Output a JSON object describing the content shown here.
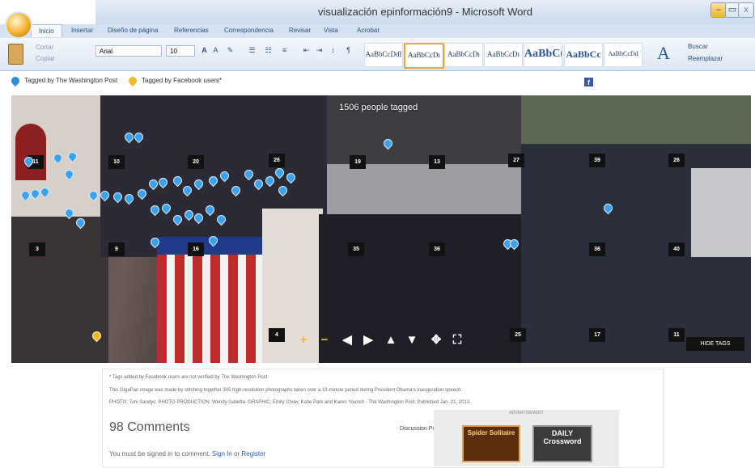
{
  "window": {
    "title": "visualización epinformación9 - Microsoft Word",
    "min_label": "–",
    "max_label": "▭",
    "close_label": "x"
  },
  "ribbon": {
    "tabs": [
      "Inicio",
      "Insertar",
      "Diseño de página",
      "Referencias",
      "Correspondencia",
      "Revisar",
      "Vista",
      "Acrobat"
    ],
    "clipboard": {
      "cut": "Cortar",
      "copy": "Copiar"
    },
    "font_name": "Arial",
    "font_size": "10",
    "styles": [
      "AaBbCcDdI",
      "AaBbCcDı",
      "AaBbCcDı",
      "AaBbCcDı",
      "AaBbC(",
      "AaBbCc",
      "AaBbCcDd"
    ],
    "find": "Buscar",
    "replace": "Reemplazar"
  },
  "legend": {
    "washington_post": "Tagged by The Washington Post",
    "facebook": "Tagged by Facebook users*",
    "facebook_icon": "f"
  },
  "panorama": {
    "tagged_count": "1506 people tagged",
    "section_numbers": [
      "11",
      "10",
      "20",
      "26",
      "19",
      "13",
      "27",
      "39",
      "26",
      "3",
      "9",
      "16",
      "35",
      "36",
      "36",
      "40",
      "4",
      "25",
      "17",
      "11"
    ],
    "controls": [
      "+",
      "−",
      "◀",
      "▶",
      "▲",
      "▼",
      "✥",
      "⛶"
    ],
    "hide_tags": "HIDE TAGS"
  },
  "footer": {
    "note1": "* Tags added by Facebook users are not verified by The Washington Post.",
    "note2": "This GigaPan image was made by stitching together 305 high-resolution photographs taken over a 13-minute period during President Obama's inauguration speech.",
    "note3": "PHOTO: Toni Sandys. PHOTO PRODUCTION: Wendy Galietta. GRAPHIC: Emily Chow, Katie Park and Karen Yourish - The Washington Post. Published Jan. 21, 2013.",
    "comments_title": "98 Comments",
    "discussion_policy": "Discussion Policy",
    "signin_prefix": "You must be signed in to comment.",
    "signin_link": "Sign In",
    "signin_or": "or",
    "register_link": "Register",
    "advertisement": "ADVERTISEMENT",
    "ad1": "Spider Solitaire",
    "ad2_line1": "DAILY",
    "ad2_line2": "Crossword"
  }
}
